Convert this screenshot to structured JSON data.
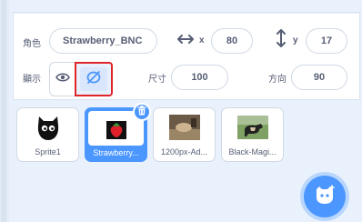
{
  "sprite_info": {
    "name_label": "角色",
    "name_value": "Strawberry_BNC",
    "x_label": "x",
    "x_value": "80",
    "y_label": "y",
    "y_value": "17",
    "show_label": "顯示",
    "size_label": "尺寸",
    "size_value": "100",
    "direction_label": "方向",
    "direction_value": "90"
  },
  "sprites": [
    {
      "name": "Sprite1",
      "selected": false
    },
    {
      "name": "Strawberry...",
      "selected": true
    },
    {
      "name": "1200px-Ad...",
      "selected": false
    },
    {
      "name": "Black-Magi...",
      "selected": false
    }
  ],
  "colors": {
    "accent": "#4c97ff",
    "highlight_box": "#e0252a",
    "text": "#575e75",
    "panel_bg": "#e9f1fc"
  },
  "icons": {
    "x_arrow": "horizontal-arrows-icon",
    "y_arrow": "vertical-arrows-icon",
    "show": "eye-icon",
    "hide": "eye-slash-icon",
    "delete": "trash-icon",
    "choose_sprite": "cat-plus-icon"
  }
}
